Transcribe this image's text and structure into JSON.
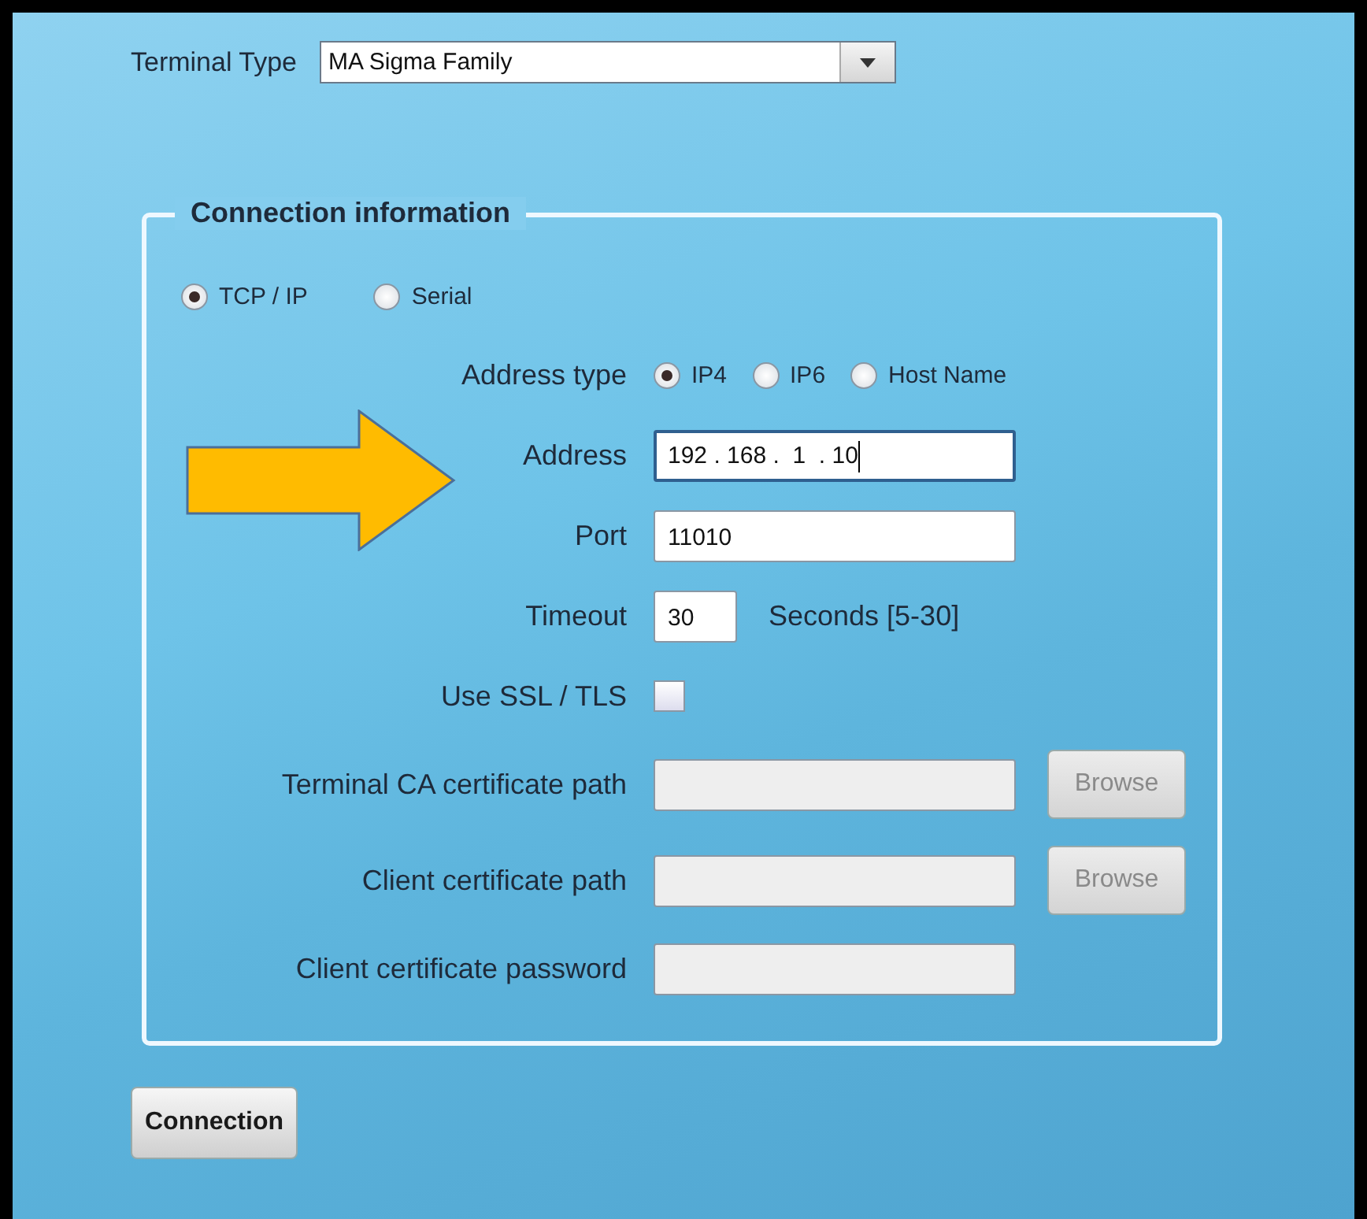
{
  "terminal_type": {
    "label": "Terminal Type",
    "value": "MA Sigma Family"
  },
  "connection": {
    "legend": "Connection information",
    "modes": [
      {
        "label": "TCP / IP",
        "selected": true
      },
      {
        "label": "Serial",
        "selected": false
      }
    ],
    "rows": [
      {
        "kind": "radio",
        "label": "Address type",
        "options": [
          {
            "label": "IP4",
            "selected": true
          },
          {
            "label": "IP6",
            "selected": false
          },
          {
            "label": "Host Name",
            "selected": false
          }
        ]
      },
      {
        "kind": "field",
        "label": "Address",
        "value": "192 . 168 .  1  . 10",
        "disabled": false,
        "focused": true
      },
      {
        "kind": "field",
        "label": "Port",
        "value": "11010",
        "disabled": false,
        "focused": false
      },
      {
        "kind": "short-field",
        "label": "Timeout",
        "value": "30",
        "suffix": "Seconds [5-30]",
        "disabled": false
      },
      {
        "kind": "checkbox",
        "label": "Use SSL / TLS",
        "checked": false
      },
      {
        "kind": "browse",
        "label": "Terminal CA certificate path",
        "disabled": true,
        "button": {
          "label": "Browse",
          "disabled": true
        }
      },
      {
        "kind": "browse",
        "label": "Client certificate path",
        "disabled": true,
        "button": {
          "label": "Browse",
          "disabled": true
        }
      },
      {
        "kind": "field",
        "label": "Client certificate password",
        "value": "",
        "disabled": true,
        "focused": false
      }
    ]
  },
  "button": {
    "label": "Connection"
  }
}
